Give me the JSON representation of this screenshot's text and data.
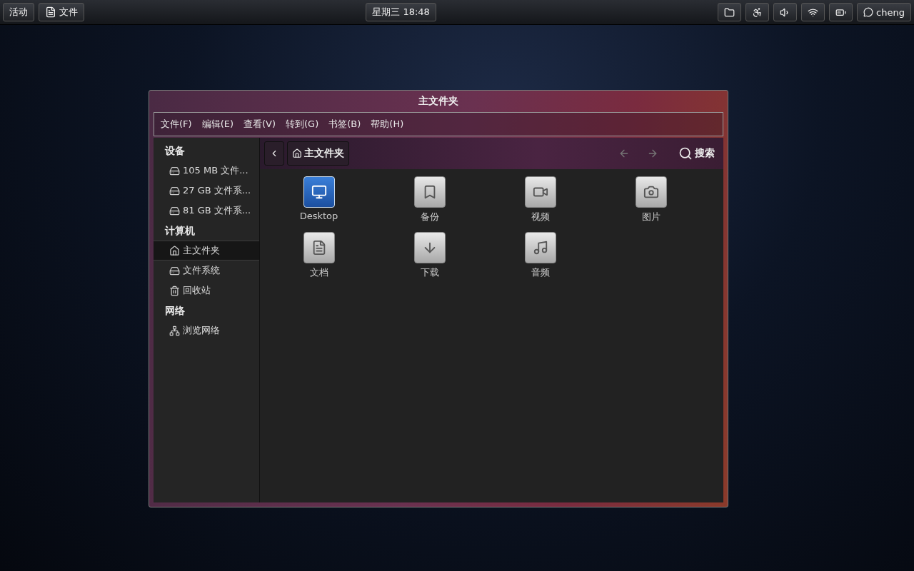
{
  "top_bar": {
    "activities": "活动",
    "app_menu": "文件",
    "clock": "星期三  18:48",
    "status_icons": [
      {
        "kind": "folder"
      },
      {
        "kind": "accessibility"
      },
      {
        "kind": "volume"
      },
      {
        "kind": "wifi"
      },
      {
        "kind": "battery"
      }
    ],
    "user": "cheng"
  },
  "window": {
    "title": "主文件夹",
    "menu": [
      "文件(F)",
      "编辑(E)",
      "查看(V)",
      "转到(G)",
      "书签(B)",
      "帮助(H)"
    ],
    "sidebar": [
      {
        "heading": "设备",
        "items": [
          {
            "label": "105 MB 文件...",
            "kind": "drive",
            "selected": false
          },
          {
            "label": "27 GB 文件系...",
            "kind": "drive",
            "selected": false
          },
          {
            "label": "81 GB 文件系...",
            "kind": "drive",
            "selected": false
          }
        ]
      },
      {
        "heading": "计算机",
        "items": [
          {
            "label": "主文件夹",
            "kind": "home",
            "selected": true
          },
          {
            "label": "文件系统",
            "kind": "drive",
            "selected": false
          },
          {
            "label": "回收站",
            "kind": "trash",
            "selected": false
          }
        ]
      },
      {
        "heading": "网络",
        "items": [
          {
            "label": "浏览网络",
            "kind": "network",
            "selected": false
          }
        ]
      }
    ],
    "path": "主文件夹",
    "search": "搜索",
    "files": [
      {
        "name": "Desktop",
        "kind": "desktop"
      },
      {
        "name": "备份",
        "kind": "bookmark"
      },
      {
        "name": "视频",
        "kind": "video"
      },
      {
        "name": "图片",
        "kind": "picture"
      },
      {
        "name": "文档",
        "kind": "document"
      },
      {
        "name": "下载",
        "kind": "download"
      },
      {
        "name": "音频",
        "kind": "music"
      }
    ]
  }
}
